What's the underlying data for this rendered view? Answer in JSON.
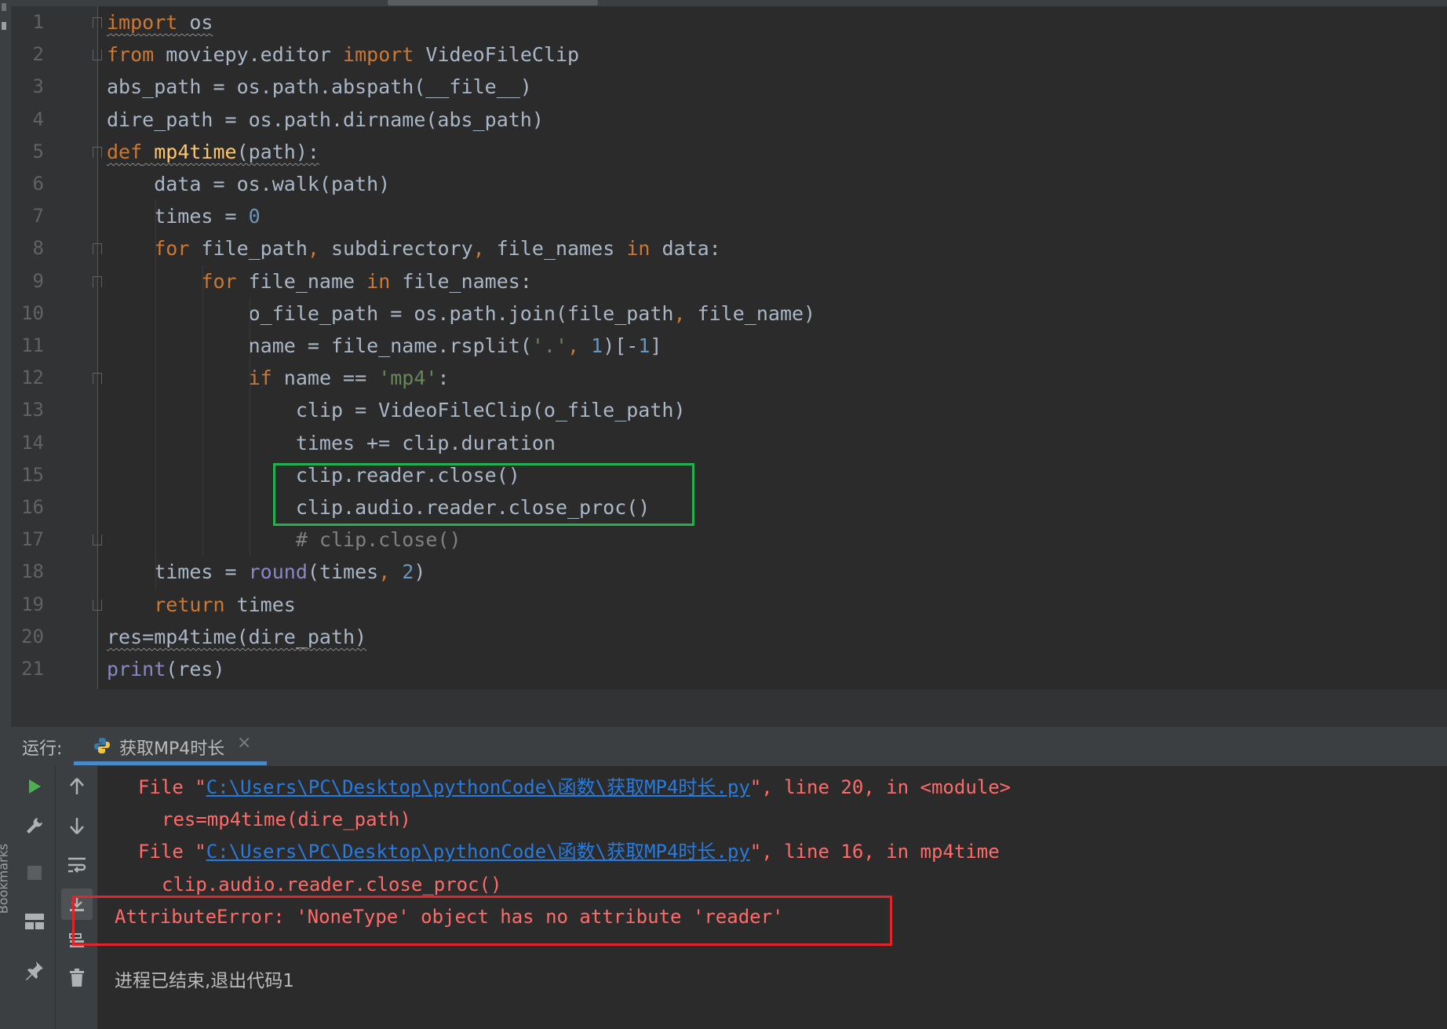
{
  "editor": {
    "lines": [
      {
        "n": "1",
        "parts": [
          [
            "kw squig",
            "import"
          ],
          [
            "squig",
            " os"
          ]
        ]
      },
      {
        "n": "2",
        "parts": [
          [
            "kw",
            "from"
          ],
          [
            "",
            " moviepy.editor "
          ],
          [
            "kw",
            "import"
          ],
          [
            "",
            " VideoFileClip"
          ]
        ]
      },
      {
        "n": "3",
        "parts": [
          [
            "",
            "abs_path = os.path.abspath(__file__)"
          ]
        ]
      },
      {
        "n": "4",
        "parts": [
          [
            "",
            "dire_path = os.path.dirname(abs_path)"
          ]
        ]
      },
      {
        "n": "5",
        "parts": [
          [
            "kw squig",
            "def"
          ],
          [
            "squig",
            " "
          ],
          [
            "fn squig",
            "mp4time"
          ],
          [
            "squig",
            "(path):"
          ]
        ]
      },
      {
        "n": "6",
        "parts": [
          [
            "",
            "    data = os.walk(path)"
          ]
        ]
      },
      {
        "n": "7",
        "parts": [
          [
            "",
            "    times = "
          ],
          [
            "num",
            "0"
          ]
        ]
      },
      {
        "n": "8",
        "parts": [
          [
            "",
            "    "
          ],
          [
            "kw",
            "for"
          ],
          [
            "",
            " file_path"
          ],
          [
            "kw",
            ","
          ],
          [
            "",
            " subdirectory"
          ],
          [
            "kw",
            ","
          ],
          [
            "",
            " file_names "
          ],
          [
            "kw",
            "in"
          ],
          [
            "",
            " data:"
          ]
        ]
      },
      {
        "n": "9",
        "parts": [
          [
            "",
            "        "
          ],
          [
            "kw",
            "for"
          ],
          [
            "",
            " file_name "
          ],
          [
            "kw",
            "in"
          ],
          [
            "",
            " file_names:"
          ]
        ]
      },
      {
        "n": "10",
        "parts": [
          [
            "",
            "            o_file_path = os.path.join(file_path"
          ],
          [
            "kw",
            ","
          ],
          [
            "",
            " file_name)"
          ]
        ]
      },
      {
        "n": "11",
        "parts": [
          [
            "",
            "            name = file_name.rsplit("
          ],
          [
            "str",
            "'.'"
          ],
          [
            "kw",
            ","
          ],
          [
            " num",
            " 1"
          ],
          [
            "",
            ")[-"
          ],
          [
            "num",
            "1"
          ],
          [
            "",
            "]"
          ]
        ]
      },
      {
        "n": "12",
        "parts": [
          [
            "",
            "            "
          ],
          [
            "kw",
            "if"
          ],
          [
            "",
            " name == "
          ],
          [
            "str",
            "'mp4'"
          ],
          [
            "",
            ":"
          ]
        ]
      },
      {
        "n": "13",
        "parts": [
          [
            "",
            "                clip = VideoFileClip(o_file_path)"
          ]
        ]
      },
      {
        "n": "14",
        "parts": [
          [
            "",
            "                times += clip.duration"
          ]
        ]
      },
      {
        "n": "15",
        "parts": [
          [
            "",
            "                clip.reader.close()"
          ]
        ]
      },
      {
        "n": "16",
        "parts": [
          [
            "",
            "                clip.audio.reader.close_proc()"
          ]
        ]
      },
      {
        "n": "17",
        "parts": [
          [
            "",
            "                "
          ],
          [
            "cmt",
            "# clip.close()"
          ]
        ]
      },
      {
        "n": "18",
        "parts": [
          [
            "",
            "    times = "
          ],
          [
            "bi",
            "round"
          ],
          [
            "",
            "(times"
          ],
          [
            "kw",
            ","
          ],
          [
            "num",
            " 2"
          ],
          [
            "",
            ")"
          ]
        ]
      },
      {
        "n": "19",
        "parts": [
          [
            "",
            "    "
          ],
          [
            "kw",
            "return"
          ],
          [
            "",
            " times"
          ]
        ]
      },
      {
        "n": "20",
        "parts": [
          [
            "squig",
            "res=mp4time(dire_path)"
          ]
        ]
      },
      {
        "n": "21",
        "parts": [
          [
            "bi",
            "print"
          ],
          [
            "",
            "(res)"
          ]
        ]
      }
    ]
  },
  "run_panel": {
    "label": "运行:",
    "tab_title": "获取MP4时长",
    "tab_close": "×"
  },
  "console": {
    "line1_pre": "File \"",
    "line1_link": "C:\\Users\\PC\\Desktop\\pythonCode\\函数\\获取MP4时长.py",
    "line1_post": "\", line 20, in <module>",
    "line2": "res=mp4time(dire_path)",
    "line3_pre": "File \"",
    "line3_link": "C:\\Users\\PC\\Desktop\\pythonCode\\函数\\获取MP4时长.py",
    "line3_post": "\", line 16, in mp4time",
    "line4": "clip.audio.reader.close_proc()",
    "error": "AttributeError: 'NoneType' object has no attribute 'reader'",
    "exit_message": "进程已结束,退出代码1"
  },
  "sidebar": {
    "bookmarks_label": "Bookmarks"
  },
  "colors": {
    "keyword": "#cc7832",
    "number": "#6897bb",
    "string": "#6a8759",
    "comment": "#808080",
    "error_text": "#ff6b68",
    "link": "#287bde",
    "highlight_green": "#23b14d",
    "highlight_red": "#e4242b"
  }
}
